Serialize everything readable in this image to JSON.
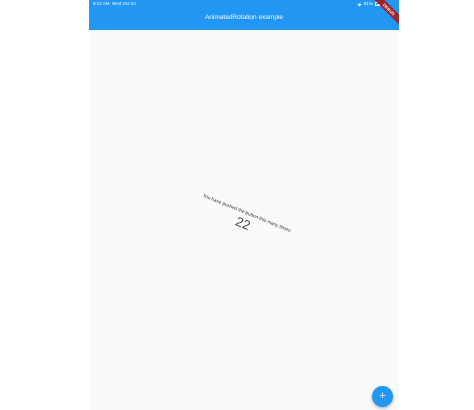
{
  "status_bar": {
    "time": "9:12 AM",
    "date": "Wed Oct 23",
    "wifi_icon": "wifi-icon",
    "battery_percent": "81%",
    "battery_icon": "battery-icon"
  },
  "app_bar": {
    "title": "AnimatedRotation example",
    "background_color": "#2196f3"
  },
  "debug_banner": {
    "label": "DEBUG",
    "color": "#a0242b"
  },
  "main": {
    "caption": "You have pushed the button this many times:",
    "counter": "22",
    "rotation_degrees": 22
  },
  "fab": {
    "icon": "plus-icon",
    "symbol": "+",
    "color": "#2196f3"
  }
}
